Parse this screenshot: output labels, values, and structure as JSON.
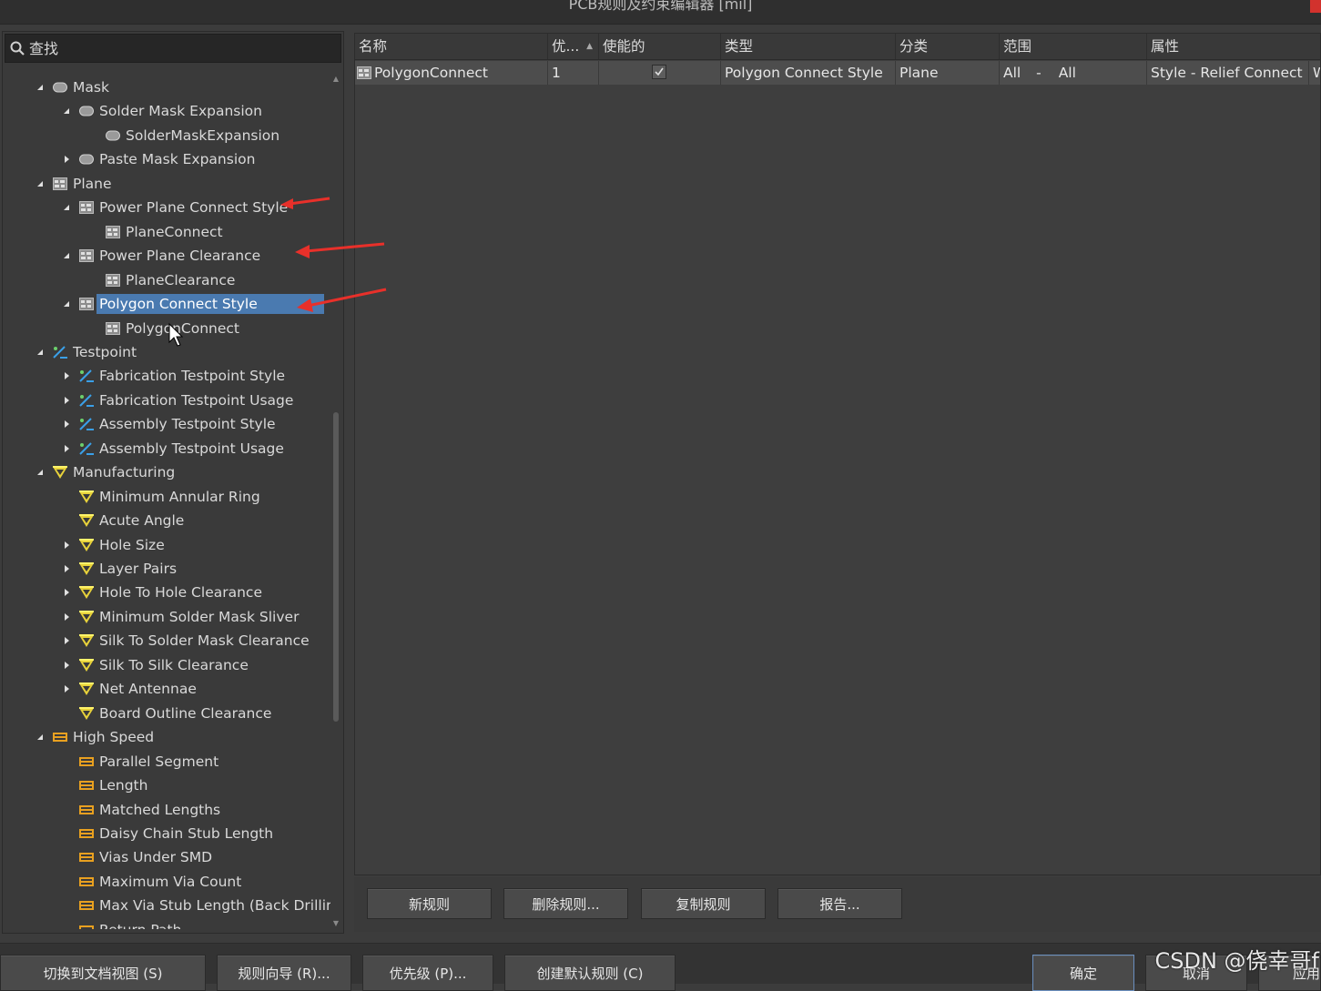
{
  "window": {
    "title": "PCB规则及约束编辑器 [mil]"
  },
  "search": {
    "placeholder": "查找"
  },
  "tree": [
    {
      "label": "Mask",
      "level": 1,
      "expand": "open",
      "icon": "mask-icon"
    },
    {
      "label": "Solder Mask Expansion",
      "level": 2,
      "expand": "open",
      "icon": "mask-icon"
    },
    {
      "label": "SolderMaskExpansion",
      "level": 3,
      "expand": "none",
      "icon": "mask-icon"
    },
    {
      "label": "Paste Mask Expansion",
      "level": 2,
      "expand": "closed",
      "icon": "mask-icon"
    },
    {
      "label": "Plane",
      "level": 1,
      "expand": "open",
      "icon": "plane-icon"
    },
    {
      "label": "Power Plane Connect Style",
      "level": 2,
      "expand": "open",
      "icon": "plane-icon"
    },
    {
      "label": "PlaneConnect",
      "level": 3,
      "expand": "none",
      "icon": "plane-icon"
    },
    {
      "label": "Power Plane Clearance",
      "level": 2,
      "expand": "open",
      "icon": "plane-icon"
    },
    {
      "label": "PlaneClearance",
      "level": 3,
      "expand": "none",
      "icon": "plane-icon"
    },
    {
      "label": "Polygon Connect Style",
      "level": 2,
      "expand": "open",
      "icon": "plane-icon",
      "selected": true
    },
    {
      "label": "PolygonConnect",
      "level": 3,
      "expand": "none",
      "icon": "plane-icon"
    },
    {
      "label": "Testpoint",
      "level": 1,
      "expand": "open",
      "icon": "testpoint-icon"
    },
    {
      "label": "Fabrication Testpoint Style",
      "level": 2,
      "expand": "closed",
      "icon": "testpoint-icon"
    },
    {
      "label": "Fabrication Testpoint Usage",
      "level": 2,
      "expand": "closed",
      "icon": "testpoint-icon"
    },
    {
      "label": "Assembly Testpoint Style",
      "level": 2,
      "expand": "closed",
      "icon": "testpoint-icon"
    },
    {
      "label": "Assembly Testpoint Usage",
      "level": 2,
      "expand": "closed",
      "icon": "testpoint-icon"
    },
    {
      "label": "Manufacturing",
      "level": 1,
      "expand": "open",
      "icon": "manufacturing-icon"
    },
    {
      "label": "Minimum Annular Ring",
      "level": 2,
      "expand": "none",
      "icon": "manufacturing-icon"
    },
    {
      "label": "Acute Angle",
      "level": 2,
      "expand": "none",
      "icon": "manufacturing-icon"
    },
    {
      "label": "Hole Size",
      "level": 2,
      "expand": "closed",
      "icon": "manufacturing-icon"
    },
    {
      "label": "Layer Pairs",
      "level": 2,
      "expand": "closed",
      "icon": "manufacturing-icon"
    },
    {
      "label": "Hole To Hole Clearance",
      "level": 2,
      "expand": "closed",
      "icon": "manufacturing-icon"
    },
    {
      "label": "Minimum Solder Mask Sliver",
      "level": 2,
      "expand": "closed",
      "icon": "manufacturing-icon"
    },
    {
      "label": "Silk To Solder Mask Clearance",
      "level": 2,
      "expand": "closed",
      "icon": "manufacturing-icon"
    },
    {
      "label": "Silk To Silk Clearance",
      "level": 2,
      "expand": "closed",
      "icon": "manufacturing-icon"
    },
    {
      "label": "Net Antennae",
      "level": 2,
      "expand": "closed",
      "icon": "manufacturing-icon"
    },
    {
      "label": "Board Outline Clearance",
      "level": 2,
      "expand": "none",
      "icon": "manufacturing-icon"
    },
    {
      "label": "High Speed",
      "level": 1,
      "expand": "open",
      "icon": "highspeed-icon"
    },
    {
      "label": "Parallel Segment",
      "level": 2,
      "expand": "none",
      "icon": "highspeed-icon"
    },
    {
      "label": "Length",
      "level": 2,
      "expand": "none",
      "icon": "highspeed-icon"
    },
    {
      "label": "Matched Lengths",
      "level": 2,
      "expand": "none",
      "icon": "highspeed-icon"
    },
    {
      "label": "Daisy Chain Stub Length",
      "level": 2,
      "expand": "none",
      "icon": "highspeed-icon"
    },
    {
      "label": "Vias Under SMD",
      "level": 2,
      "expand": "none",
      "icon": "highspeed-icon"
    },
    {
      "label": "Maximum Via Count",
      "level": 2,
      "expand": "none",
      "icon": "highspeed-icon"
    },
    {
      "label": "Max Via Stub Length (Back Drilling",
      "level": 2,
      "expand": "none",
      "icon": "highspeed-icon"
    },
    {
      "label": "Return Path",
      "level": 2,
      "expand": "none",
      "icon": "highspeed-icon"
    }
  ],
  "grid": {
    "headers": [
      "名称",
      "优...",
      "使能的",
      "类型",
      "分类",
      "范围",
      "属性"
    ],
    "row": {
      "name": "PolygonConnect",
      "priority": "1",
      "enabled": true,
      "type": "Polygon Connect Style",
      "category": "Plane",
      "scope_a": "All",
      "scope_sep": "-",
      "scope_b": "All",
      "attribute": "Style - Relief Connect",
      "overflow": "W"
    }
  },
  "grid_buttons": {
    "new_rule": "新规则",
    "delete_rule": "删除规则...",
    "copy_rule": "复制规则",
    "report": "报告..."
  },
  "bottom_buttons": {
    "switch_view": "切换到文档视图 (S)",
    "rule_wizard": "规则向导 (R)...",
    "priority": "优先级 (P)...",
    "create_default": "创建默认规则 (C)",
    "ok": "确定",
    "cancel": "取消",
    "apply": "应用"
  },
  "watermark": "CSDN @侥幸哥f",
  "colors": {
    "selection": "#4a7ab0",
    "annotation_arrow": "#e8302a",
    "manufacturing_icon": "#e8d23a",
    "highspeed_icon": "#e8a020",
    "testpoint_icon": "#3aa0e8"
  }
}
